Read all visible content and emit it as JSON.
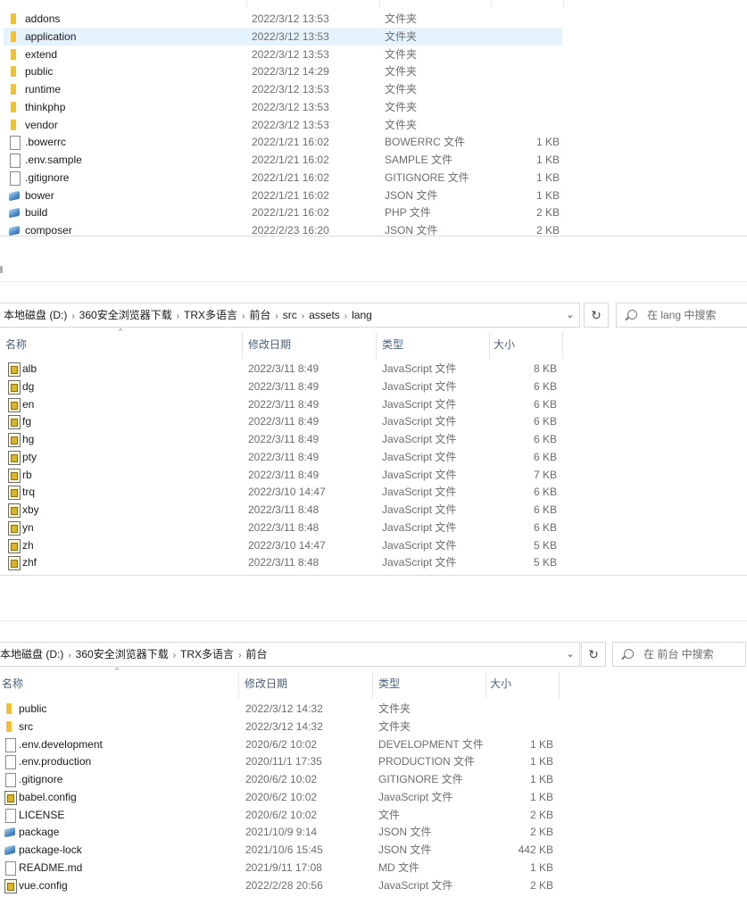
{
  "pane1": {
    "rows": [
      {
        "name": "addons",
        "date": "2022/3/12 13:53",
        "type": "文件夹",
        "size": "",
        "icon": "folder-icon"
      },
      {
        "name": "application",
        "date": "2022/3/12 13:53",
        "type": "文件夹",
        "size": "",
        "icon": "folder-icon",
        "selected": true
      },
      {
        "name": "extend",
        "date": "2022/3/12 13:53",
        "type": "文件夹",
        "size": "",
        "icon": "folder-icon"
      },
      {
        "name": "public",
        "date": "2022/3/12 14:29",
        "type": "文件夹",
        "size": "",
        "icon": "folder-icon"
      },
      {
        "name": "runtime",
        "date": "2022/3/12 13:53",
        "type": "文件夹",
        "size": "",
        "icon": "folder-icon"
      },
      {
        "name": "thinkphp",
        "date": "2022/3/12 13:53",
        "type": "文件夹",
        "size": "",
        "icon": "folder-icon"
      },
      {
        "name": "vendor",
        "date": "2022/3/12 13:53",
        "type": "文件夹",
        "size": "",
        "icon": "folder-icon"
      },
      {
        "name": ".bowerrc",
        "date": "2022/1/21 16:02",
        "type": "BOWERRC 文件",
        "size": "1 KB",
        "icon": "file-icon"
      },
      {
        "name": ".env.sample",
        "date": "2022/1/21 16:02",
        "type": "SAMPLE 文件",
        "size": "1 KB",
        "icon": "file-icon"
      },
      {
        "name": ".gitignore",
        "date": "2022/1/21 16:02",
        "type": "GITIGNORE 文件",
        "size": "1 KB",
        "icon": "file-icon"
      },
      {
        "name": "bower",
        "date": "2022/1/21 16:02",
        "type": "JSON 文件",
        "size": "1 KB",
        "icon": "json-file-icon"
      },
      {
        "name": "build",
        "date": "2022/1/21 16:02",
        "type": "PHP 文件",
        "size": "2 KB",
        "icon": "json-file-icon"
      },
      {
        "name": "composer",
        "date": "2022/2/23 16:20",
        "type": "JSON 文件",
        "size": "2 KB",
        "icon": "json-file-icon"
      }
    ]
  },
  "pane2": {
    "breadcrumb": [
      "本地磁盘 (D:)",
      "360安全浏览器下载",
      "TRX多语言",
      "前台",
      "src",
      "assets",
      "lang"
    ],
    "search_placeholder": "在 lang 中搜索",
    "dropdown_glyph": "⌄",
    "refresh_glyph": "↻",
    "columns": {
      "name": "名称",
      "date": "修改日期",
      "type": "类型",
      "size": "大小"
    },
    "sort_glyph": "^",
    "rows": [
      {
        "name": "alb",
        "date": "2022/3/11 8:49",
        "type": "JavaScript 文件",
        "size": "8 KB",
        "icon": "js-file-icon"
      },
      {
        "name": "dg",
        "date": "2022/3/11 8:49",
        "type": "JavaScript 文件",
        "size": "6 KB",
        "icon": "js-file-icon"
      },
      {
        "name": "en",
        "date": "2022/3/11 8:49",
        "type": "JavaScript 文件",
        "size": "6 KB",
        "icon": "js-file-icon"
      },
      {
        "name": "fg",
        "date": "2022/3/11 8:49",
        "type": "JavaScript 文件",
        "size": "6 KB",
        "icon": "js-file-icon"
      },
      {
        "name": "hg",
        "date": "2022/3/11 8:49",
        "type": "JavaScript 文件",
        "size": "6 KB",
        "icon": "js-file-icon"
      },
      {
        "name": "pty",
        "date": "2022/3/11 8:49",
        "type": "JavaScript 文件",
        "size": "6 KB",
        "icon": "js-file-icon"
      },
      {
        "name": "rb",
        "date": "2022/3/11 8:49",
        "type": "JavaScript 文件",
        "size": "7 KB",
        "icon": "js-file-icon"
      },
      {
        "name": "trq",
        "date": "2022/3/10 14:47",
        "type": "JavaScript 文件",
        "size": "6 KB",
        "icon": "js-file-icon"
      },
      {
        "name": "xby",
        "date": "2022/3/11 8:48",
        "type": "JavaScript 文件",
        "size": "6 KB",
        "icon": "js-file-icon"
      },
      {
        "name": "yn",
        "date": "2022/3/11 8:48",
        "type": "JavaScript 文件",
        "size": "6 KB",
        "icon": "js-file-icon"
      },
      {
        "name": "zh",
        "date": "2022/3/10 14:47",
        "type": "JavaScript 文件",
        "size": "5 KB",
        "icon": "js-file-icon"
      },
      {
        "name": "zhf",
        "date": "2022/3/11 8:48",
        "type": "JavaScript 文件",
        "size": "5 KB",
        "icon": "js-file-icon"
      }
    ]
  },
  "pane3": {
    "breadcrumb": [
      "本地磁盘 (D:)",
      "360安全浏览器下载",
      "TRX多语言",
      "前台"
    ],
    "search_placeholder": "在 前台 中搜索",
    "dropdown_glyph": "⌄",
    "refresh_glyph": "↻",
    "columns": {
      "name": "名称",
      "date": "修改日期",
      "type": "类型",
      "size": "大小"
    },
    "sort_glyph": "^",
    "rows": [
      {
        "name": "public",
        "date": "2022/3/12 14:32",
        "type": "文件夹",
        "size": "",
        "icon": "folder-icon"
      },
      {
        "name": "src",
        "date": "2022/3/12 14:32",
        "type": "文件夹",
        "size": "",
        "icon": "folder-icon"
      },
      {
        "name": ".env.development",
        "date": "2020/6/2 10:02",
        "type": "DEVELOPMENT 文件",
        "size": "1 KB",
        "icon": "file-icon"
      },
      {
        "name": ".env.production",
        "date": "2020/11/1 17:35",
        "type": "PRODUCTION 文件",
        "size": "1 KB",
        "icon": "file-icon"
      },
      {
        "name": ".gitignore",
        "date": "2020/6/2 10:02",
        "type": "GITIGNORE 文件",
        "size": "1 KB",
        "icon": "file-icon"
      },
      {
        "name": "babel.config",
        "date": "2020/6/2 10:02",
        "type": "JavaScript 文件",
        "size": "1 KB",
        "icon": "js-file-icon"
      },
      {
        "name": "LICENSE",
        "date": "2020/6/2 10:02",
        "type": "文件",
        "size": "2 KB",
        "icon": "file-icon"
      },
      {
        "name": "package",
        "date": "2021/10/9 9:14",
        "type": "JSON 文件",
        "size": "2 KB",
        "icon": "json-file-icon"
      },
      {
        "name": "package-lock",
        "date": "2021/10/6 15:45",
        "type": "JSON 文件",
        "size": "442 KB",
        "icon": "json-file-icon"
      },
      {
        "name": "README.md",
        "date": "2021/9/11 17:08",
        "type": "MD 文件",
        "size": "1 KB",
        "icon": "file-icon"
      },
      {
        "name": "vue.config",
        "date": "2022/2/28 20:56",
        "type": "JavaScript 文件",
        "size": "2 KB",
        "icon": "js-file-icon"
      }
    ]
  },
  "colors": {
    "selection": "#e5f3ff",
    "header_text": "#4c607a",
    "folder": "#f2c037"
  }
}
